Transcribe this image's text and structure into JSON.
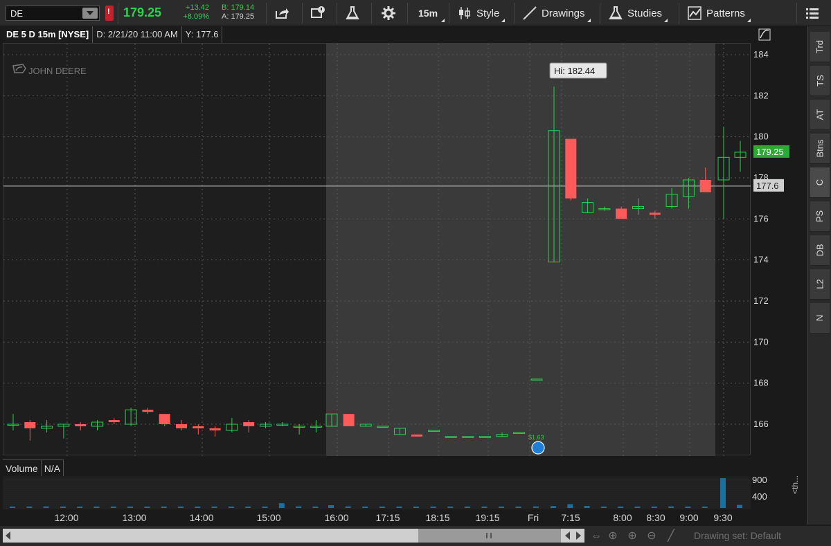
{
  "toolbar": {
    "symbol": "DE",
    "alert": "!",
    "last": "179.25",
    "change": "+13.42",
    "change_pct": "+8.09%",
    "bid": "B: 179.14",
    "ask": "A: 179.25",
    "timeframe": "15m",
    "style": "Style",
    "drawings": "Drawings",
    "studies": "Studies",
    "patterns": "Patterns"
  },
  "header": {
    "symbol": "DE 5 D 15m [NYSE]",
    "date": "D: 2/21/20 11:00 AM",
    "y": "Y: 177.6"
  },
  "chart": {
    "watermark": "JOHN DEERE",
    "hi_label": "Hi: 182.44",
    "dividend_label": "$1.63",
    "last_price_label": "179.25",
    "crosshair_label": "177.6",
    "y_ticks": [
      "184",
      "182",
      "180",
      "178",
      "176",
      "174",
      "172",
      "170",
      "168",
      "166"
    ],
    "x_ticks": [
      "12:00",
      "13:00",
      "14:00",
      "15:00",
      "16:00",
      "17:15",
      "18:15",
      "19:15",
      "Fri",
      "7:15",
      "8:00",
      "8:30",
      "9:00",
      "9:30"
    ]
  },
  "volume": {
    "label": "Volume",
    "value": "N/A",
    "ticks": [
      "900",
      "400"
    ],
    "collapsed": "<th..."
  },
  "side_tabs": [
    "Trd",
    "TS",
    "AT",
    "Btns",
    "C",
    "PS",
    "DB",
    "L2",
    "N"
  ],
  "bottom": {
    "drawing_set": "Drawing set: Default"
  },
  "colors": {
    "up": "#2fd050",
    "down": "#ff5a5a",
    "crosshair": "#c8c8c8"
  },
  "chart_data": {
    "type": "candlestick",
    "y_range": [
      164.5,
      185
    ],
    "candles": [
      {
        "x": "11:00",
        "o": 166.0,
        "h": 166.5,
        "l": 165.7,
        "c": 166.0
      },
      {
        "x": "11:15",
        "o": 166.1,
        "h": 166.2,
        "l": 165.2,
        "c": 165.8
      },
      {
        "x": "11:30",
        "o": 165.8,
        "h": 166.2,
        "l": 165.6,
        "c": 165.9
      },
      {
        "x": "11:45",
        "o": 165.9,
        "h": 166.0,
        "l": 165.3,
        "c": 166.0
      },
      {
        "x": "12:00",
        "o": 166.0,
        "h": 166.1,
        "l": 165.7,
        "c": 165.9
      },
      {
        "x": "12:15",
        "o": 165.9,
        "h": 166.2,
        "l": 165.7,
        "c": 166.1
      },
      {
        "x": "12:30",
        "o": 166.2,
        "h": 166.3,
        "l": 166.0,
        "c": 166.1
      },
      {
        "x": "12:45",
        "o": 166.0,
        "h": 166.8,
        "l": 165.9,
        "c": 166.7
      },
      {
        "x": "13:00",
        "o": 166.7,
        "h": 166.8,
        "l": 166.5,
        "c": 166.6
      },
      {
        "x": "13:15",
        "o": 166.5,
        "h": 166.5,
        "l": 165.9,
        "c": 166.0
      },
      {
        "x": "13:30",
        "o": 166.0,
        "h": 166.2,
        "l": 165.7,
        "c": 165.8
      },
      {
        "x": "13:45",
        "o": 165.9,
        "h": 166.0,
        "l": 165.5,
        "c": 165.8
      },
      {
        "x": "14:00",
        "o": 165.8,
        "h": 165.9,
        "l": 165.4,
        "c": 165.7
      },
      {
        "x": "14:15",
        "o": 165.7,
        "h": 166.3,
        "l": 165.6,
        "c": 166.0
      },
      {
        "x": "14:30",
        "o": 166.1,
        "h": 166.2,
        "l": 165.6,
        "c": 165.9
      },
      {
        "x": "14:45",
        "o": 165.9,
        "h": 166.1,
        "l": 165.8,
        "c": 166.0
      },
      {
        "x": "15:00",
        "o": 166.0,
        "h": 166.1,
        "l": 165.9,
        "c": 166.0
      },
      {
        "x": "15:15",
        "o": 165.9,
        "h": 166.0,
        "l": 165.5,
        "c": 165.9
      },
      {
        "x": "15:30",
        "o": 165.9,
        "h": 166.2,
        "l": 165.6,
        "c": 165.9
      },
      {
        "x": "16:00",
        "o": 165.9,
        "h": 166.5,
        "l": 165.9,
        "c": 166.5
      },
      {
        "x": "16:15",
        "o": 166.5,
        "h": 166.5,
        "l": 165.9,
        "c": 165.9
      },
      {
        "x": "16:30",
        "o": 165.9,
        "h": 166.0,
        "l": 165.9,
        "c": 166.0
      },
      {
        "x": "16:45",
        "o": 165.9,
        "h": 165.9,
        "l": 165.9,
        "c": 165.9
      },
      {
        "x": "17:15",
        "o": 165.5,
        "h": 165.8,
        "l": 165.5,
        "c": 165.8
      },
      {
        "x": "17:45",
        "o": 165.5,
        "h": 165.5,
        "l": 165.4,
        "c": 165.4
      },
      {
        "x": "18:15",
        "o": 165.7,
        "h": 165.7,
        "l": 165.7,
        "c": 165.7
      },
      {
        "x": "18:45",
        "o": 165.4,
        "h": 165.4,
        "l": 165.4,
        "c": 165.4
      },
      {
        "x": "19:00",
        "o": 165.4,
        "h": 165.4,
        "l": 165.4,
        "c": 165.4
      },
      {
        "x": "19:15",
        "o": 165.4,
        "h": 165.4,
        "l": 165.4,
        "c": 165.4
      },
      {
        "x": "19:30",
        "o": 165.4,
        "h": 165.6,
        "l": 165.4,
        "c": 165.5
      },
      {
        "x": "19:45",
        "o": 165.6,
        "h": 165.6,
        "l": 165.6,
        "c": 165.6
      },
      {
        "x": "6:45",
        "o": 168.2,
        "h": 168.2,
        "l": 168.2,
        "c": 168.2
      },
      {
        "x": "7:00",
        "o": 173.9,
        "h": 182.44,
        "l": 173.9,
        "c": 180.3
      },
      {
        "x": "7:15",
        "o": 179.9,
        "h": 179.9,
        "l": 176.9,
        "c": 177.0
      },
      {
        "x": "7:30",
        "o": 176.3,
        "h": 177.0,
        "l": 176.3,
        "c": 176.8
      },
      {
        "x": "7:45",
        "o": 176.5,
        "h": 176.6,
        "l": 176.4,
        "c": 176.5
      },
      {
        "x": "8:00",
        "o": 176.5,
        "h": 176.6,
        "l": 176.0,
        "c": 176.0
      },
      {
        "x": "8:15",
        "o": 176.5,
        "h": 177.0,
        "l": 176.2,
        "c": 176.6
      },
      {
        "x": "8:30",
        "o": 176.3,
        "h": 176.4,
        "l": 176.0,
        "c": 176.2
      },
      {
        "x": "8:45",
        "o": 176.6,
        "h": 177.5,
        "l": 176.5,
        "c": 177.2
      },
      {
        "x": "9:00",
        "o": 177.1,
        "h": 178.0,
        "l": 176.5,
        "c": 177.9
      },
      {
        "x": "9:15",
        "o": 177.9,
        "h": 178.5,
        "l": 177.3,
        "c": 177.3
      },
      {
        "x": "9:30",
        "o": 177.9,
        "h": 180.5,
        "l": 176.0,
        "c": 179.0
      },
      {
        "x": "9:45",
        "o": 179.0,
        "h": 179.8,
        "l": 178.3,
        "c": 179.25
      }
    ],
    "volume": [
      40,
      30,
      45,
      30,
      35,
      30,
      30,
      40,
      30,
      25,
      30,
      30,
      40,
      30,
      30,
      35,
      140,
      45,
      30,
      80,
      45,
      30,
      25,
      25,
      30,
      35,
      30,
      25,
      30,
      30,
      30,
      45,
      55,
      110,
      60,
      40,
      40,
      30,
      30,
      45,
      40,
      30,
      880,
      90
    ]
  }
}
